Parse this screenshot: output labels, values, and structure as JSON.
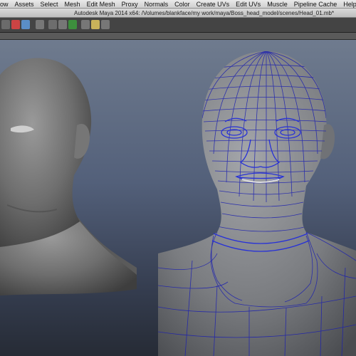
{
  "menu": {
    "items": [
      "low",
      "Assets",
      "Select",
      "Mesh",
      "Edit Mesh",
      "Proxy",
      "Normals",
      "Color",
      "Create UVs",
      "Edit UVs",
      "Muscle",
      "Pipeline Cache",
      "Help"
    ]
  },
  "window": {
    "title": "Autodesk Maya 2014 x64: /Volumes/blankface/my work/maya/Boss_head_model/scenes/Head_01.mb*"
  },
  "toolbar": {
    "icons": [
      "select-tool-icon",
      "lasso-icon",
      "paint-select-icon",
      "magnet-snap-icon",
      "history-icon",
      "render-icon",
      "render-view-icon",
      "ipr-icon",
      "render-settings-icon",
      "hypershade-icon"
    ]
  },
  "viewport": {
    "background_top": "#6f7b8e",
    "background_bottom": "#262b35",
    "wire_color": "#2222cc"
  }
}
